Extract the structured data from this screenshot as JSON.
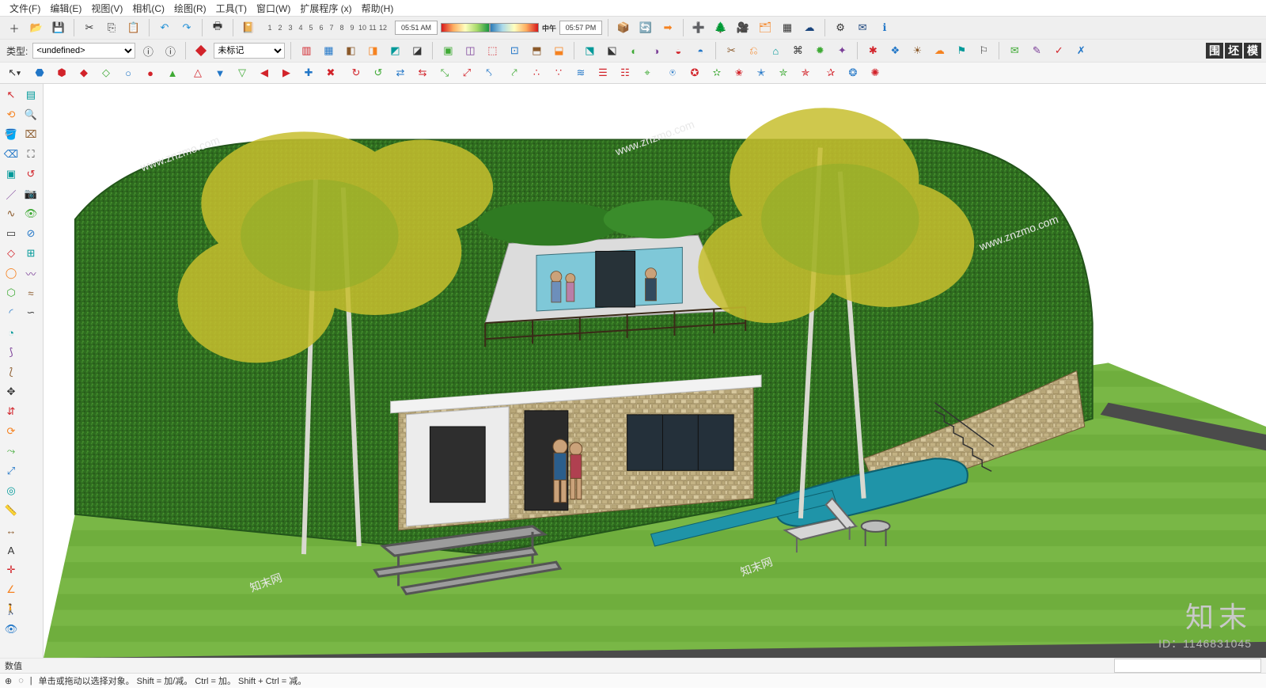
{
  "menu": {
    "items": [
      "文件(F)",
      "编辑(E)",
      "视图(V)",
      "相机(C)",
      "绘图(R)",
      "工具(T)",
      "窗口(W)",
      "扩展程序 (x)",
      "帮助(H)"
    ]
  },
  "row1": {
    "type_label": "类型:",
    "type_value": "<undefined>",
    "tag_default": "未标记"
  },
  "timebar": {
    "numbers": [
      "1",
      "2",
      "3",
      "4",
      "5",
      "6",
      "7",
      "8",
      "9",
      "10",
      "11",
      "12"
    ],
    "t1": "05:51 AM",
    "mid": "中午",
    "t2": "05:57 PM"
  },
  "badge": [
    "围",
    "坯",
    "模"
  ],
  "arrowrow": {
    "selval": "▾"
  },
  "statusbar": {
    "measure_label": "数值",
    "hint": "单击或拖动以选择对象。 Shift = 加/减。 Ctrl = 加。 Shift + Ctrl = 减。"
  },
  "viewport": {
    "watermark": "知末",
    "model_id": "ID：1146831045"
  },
  "leftTools": [
    "select-icon",
    "orbit-icon",
    "paint-bucket-icon",
    "eraser-icon",
    "component-icon",
    "line-icon",
    "freehand-icon",
    "rectangle-icon",
    "rotated-rect-icon",
    "circle-icon",
    "polygon-icon",
    "arc-icon",
    "pie-icon",
    "arc2-icon",
    "arc3-icon",
    "move-icon",
    "pushpull-icon",
    "rotate-icon",
    "followme-icon",
    "scale-icon",
    "offset-icon",
    "tape-icon",
    "dimension-icon",
    "text-icon",
    "axes-icon",
    "protractor-icon",
    "walk-icon",
    "lookaround-icon",
    "section-icon",
    "zoom-icon",
    "zoom-window-icon",
    "zoom-extents-icon",
    "prev-view-icon",
    "position-camera-icon",
    "eye-icon",
    "hide-icon",
    "xray-icon",
    "sandbox1-icon",
    "sandbox2-icon",
    "sandbox3-icon"
  ],
  "row2Icons": [
    "layers-icon",
    "paste-icon",
    "group-icon",
    "explode-icon",
    "hide-rest-icon",
    "soften-icon",
    "intersect-icon",
    "style-icon",
    "shadows-icon",
    "fog-icon",
    "edges-icon",
    "profiles-icon",
    "endpoints-icon",
    "match-photo-icon",
    "geo-icon",
    "import-icon",
    "export-icon",
    "3dtext-icon",
    "section-display-icon",
    "section-fill-icon",
    "section-cut-icon",
    "solid-union-icon",
    "solid-subtract-icon",
    "solid-trim-icon",
    "solid-intersect-icon",
    "solid-split-icon",
    "outer-shell-icon",
    "sandbox-from-contours-icon",
    "sandbox-from-scratch-icon",
    "smoove-icon",
    "stamp-icon",
    "drape-icon",
    "add-detail-icon",
    "flip-edge-icon"
  ],
  "row3Icons": [
    "plugin1-icon",
    "plugin2-icon",
    "plugin3-icon",
    "plugin4-icon",
    "plugin5-icon",
    "plugin6-icon",
    "plugin7-icon",
    "plugin8-icon",
    "plugin9-icon",
    "plugin10-icon",
    "plugin11-icon",
    "plugin12-icon",
    "plugin13-icon",
    "plugin14-icon",
    "plugin15-icon",
    "plugin16-icon",
    "plugin17-icon",
    "plugin18-icon",
    "plugin19-icon",
    "plugin20-icon",
    "plugin21-icon",
    "plugin22-icon",
    "plugin23-icon",
    "plugin24-icon",
    "plugin25-icon",
    "plugin26-icon",
    "plugin27-icon",
    "plugin28-icon",
    "plugin29-icon",
    "plugin30-icon",
    "plugin31-icon",
    "plugin32-icon",
    "plugin33-icon",
    "plugin34-icon",
    "plugin35-icon",
    "plugin36-icon",
    "plugin37-icon",
    "plugin38-icon"
  ],
  "iconGlyphs": {
    "new-icon": "＋",
    "open-icon": "📂",
    "save-icon": "💾",
    "cut-icon": "✂",
    "copy-icon": "⎘",
    "paste-icon": "📋",
    "undo-icon": "↶",
    "redo-icon": "↷",
    "print-icon": "🖶",
    "select-icon": "↖",
    "orbit-icon": "⟲",
    "paint-bucket-icon": "🪣",
    "eraser-icon": "⌫",
    "component-icon": "▣",
    "line-icon": "／",
    "freehand-icon": "∿",
    "rectangle-icon": "▭",
    "rotated-rect-icon": "◇",
    "circle-icon": "◯",
    "polygon-icon": "⬡",
    "arc-icon": "◜",
    "pie-icon": "◔",
    "arc2-icon": "⟆",
    "arc3-icon": "⟅",
    "move-icon": "✥",
    "pushpull-icon": "⇵",
    "rotate-icon": "⟳",
    "followme-icon": "⤳",
    "scale-icon": "⤢",
    "offset-icon": "◎",
    "tape-icon": "📏",
    "dimension-icon": "↔",
    "text-icon": "A",
    "axes-icon": "✛",
    "protractor-icon": "∠",
    "walk-icon": "🚶",
    "lookaround-icon": "👁",
    "section-icon": "▤",
    "zoom-icon": "🔍",
    "zoom-window-icon": "⌧",
    "zoom-extents-icon": "⛶",
    "prev-view-icon": "↺",
    "position-camera-icon": "📷",
    "eye-icon": "👁",
    "hide-icon": "⊘",
    "xray-icon": "⊞",
    "sandbox1-icon": "〰",
    "sandbox2-icon": "≈",
    "sandbox3-icon": "∽",
    "ext-box-icon": "📦",
    "ext-sync-icon": "🔄",
    "ext-arrow-icon": "➡",
    "ext-plus-icon": "➕",
    "ext-tree-icon": "🌲",
    "ext-cam-icon": "🎥",
    "ext-layer-icon": "🗂",
    "ext-checker-icon": "▦",
    "ext-cloud-icon": "☁",
    "ext-gear-icon": "⚙",
    "ext-mail-icon": "✉",
    "ext-info-icon": "ℹ"
  },
  "colors": {
    "red": "#d2232a",
    "orange": "#f58220",
    "yellow": "#ffd400",
    "green": "#3faa35",
    "teal": "#009999",
    "blue": "#2176c7",
    "navy": "#1a447c",
    "purple": "#7b3f98",
    "brown": "#8b5a2b",
    "gray": "#888888"
  }
}
